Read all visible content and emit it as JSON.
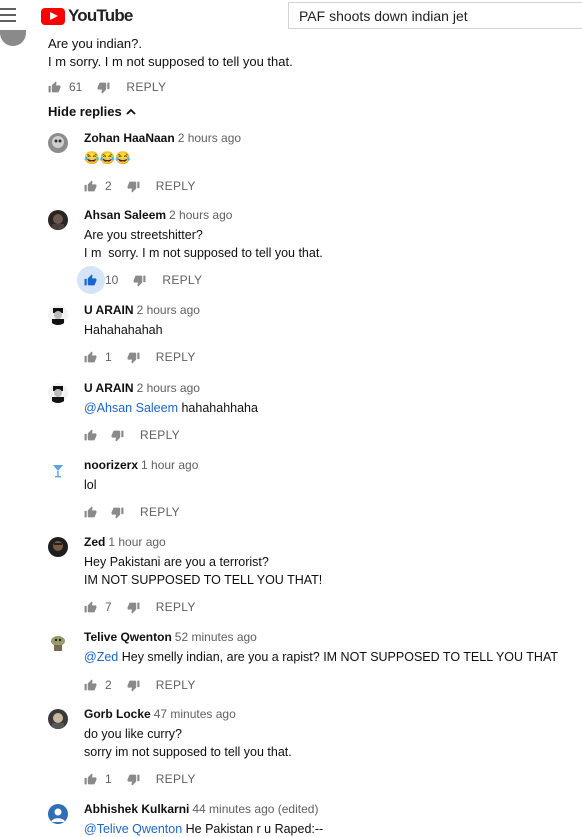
{
  "header": {
    "logo_text": "YouTube",
    "search_value": "PAF shoots down indian jet"
  },
  "parent": {
    "line1": "Are you indian?.",
    "line2": "I m sorry. I m not supposed to tell you that.",
    "likes": "61",
    "reply_label": "REPLY"
  },
  "hide_replies_label": "Hide replies",
  "colors": {
    "link": "#1a66d1",
    "liked_thumb": "#1a66d1",
    "logo_red": "#ff0000"
  },
  "replies": [
    {
      "author": "Zohan HaaNaan",
      "time": "2 hours ago",
      "lines": [
        "😂😂😂"
      ],
      "likes": "2",
      "reply_label": "REPLY",
      "avatar_icon": "gray-avatar-icon"
    },
    {
      "author": "Ahsan Saleem",
      "time": "2 hours ago",
      "lines": [
        "Are you streetshitter?",
        "I m  sorry. I m not supposed to tell you that."
      ],
      "likes": "10",
      "liked": true,
      "reply_label": "REPLY",
      "avatar_icon": "dark-avatar-icon"
    },
    {
      "author": "U ARAIN",
      "time": "2 hours ago",
      "lines": [
        "Hahahahahah"
      ],
      "likes": "1",
      "reply_label": "REPLY",
      "avatar_icon": "bw-avatar-icon"
    },
    {
      "author": "U ARAIN",
      "time": "2 hours ago",
      "mention": "@Ahsan Saleem",
      "lines": [
        "hahahahhaha"
      ],
      "likes": "",
      "reply_label": "REPLY",
      "avatar_icon": "bw-avatar-icon"
    },
    {
      "author": "noorizerx",
      "time": "1 hour ago",
      "lines": [
        "lol"
      ],
      "likes": "",
      "reply_label": "REPLY",
      "avatar_icon": "cocktail-avatar-icon"
    },
    {
      "author": "Zed",
      "time": "1 hour ago",
      "lines": [
        "Hey Pakistani are you a terrorist?",
        "IM NOT SUPPOSED TO TELL YOU THAT!"
      ],
      "likes": "7",
      "reply_label": "REPLY",
      "avatar_icon": "dark-avatar-icon"
    },
    {
      "author": "Telive Qwenton",
      "time": "52 minutes ago",
      "mention": "@Zed",
      "lines": [
        "Hey smelly indian, are you a rapist? IM NOT SUPPOSED TO TELL YOU THAT"
      ],
      "likes": "2",
      "reply_label": "REPLY",
      "avatar_icon": "character-avatar-icon"
    },
    {
      "author": "Gorb Locke",
      "time": "47 minutes ago",
      "lines": [
        "do you like curry?",
        "sorry im not supposed to tell you that."
      ],
      "likes": "1",
      "reply_label": "REPLY",
      "avatar_icon": "portrait-avatar-icon"
    },
    {
      "author": "Abhishek Kulkarni",
      "time": "44 minutes ago (edited)",
      "mention": "@Telive Qwenton",
      "lines": [
        "He Pakistan r u Raped:--"
      ],
      "likes": "",
      "reply_label": "",
      "avatar_icon": "default-blue-avatar-icon"
    }
  ]
}
